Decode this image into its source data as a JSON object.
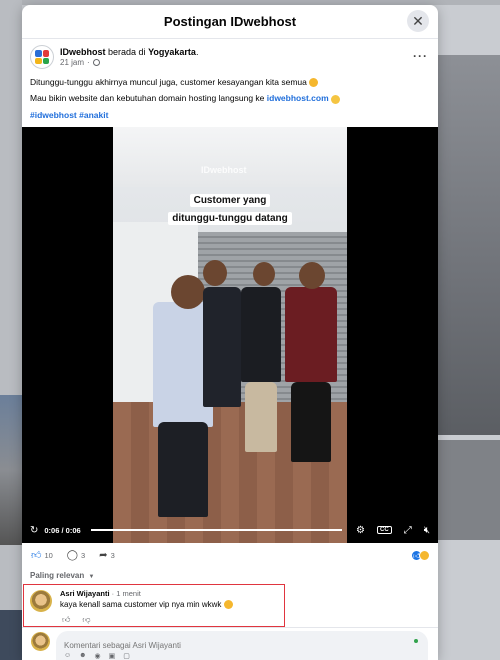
{
  "modal": {
    "title": "Postingan IDwebhost",
    "close_icon": "close-icon"
  },
  "post": {
    "author": "IDwebhost",
    "at_text": "berada di",
    "location": "Yogyakarta",
    "time": "21 jam",
    "privacy_icon": "globe-icon",
    "more_icon": "more-options-icon",
    "line1": "Ditunggu-tunggu akhirnya muncul juga, customer kesayangan kita semua",
    "line2_prefix": "Mau bikin website dan kebutuhan domain hosting langsung ke",
    "line2_link": "idwebhost.com",
    "hashtags": "#idwebhost #anakit"
  },
  "video": {
    "watermark": "IDwebhost",
    "caption_line1": "Customer yang",
    "caption_line2": "ditunggu-tunggu datang",
    "time": "0:06 / 0:06",
    "progress": 1.0
  },
  "reactions": {
    "likes": "10",
    "comments": "3",
    "shares": "3"
  },
  "sort_label": "Paling relevan",
  "comments": [
    {
      "name": "Asri Wijayanti",
      "time": "1 menit",
      "text": "kaya kenall sama customer vip nya min wkwk"
    }
  ],
  "composer": {
    "placeholder": "Komentari sebagai Asri Wijayanti"
  },
  "colors": {
    "accent": "#1b74e4",
    "highlight_border": "#e0353f"
  }
}
